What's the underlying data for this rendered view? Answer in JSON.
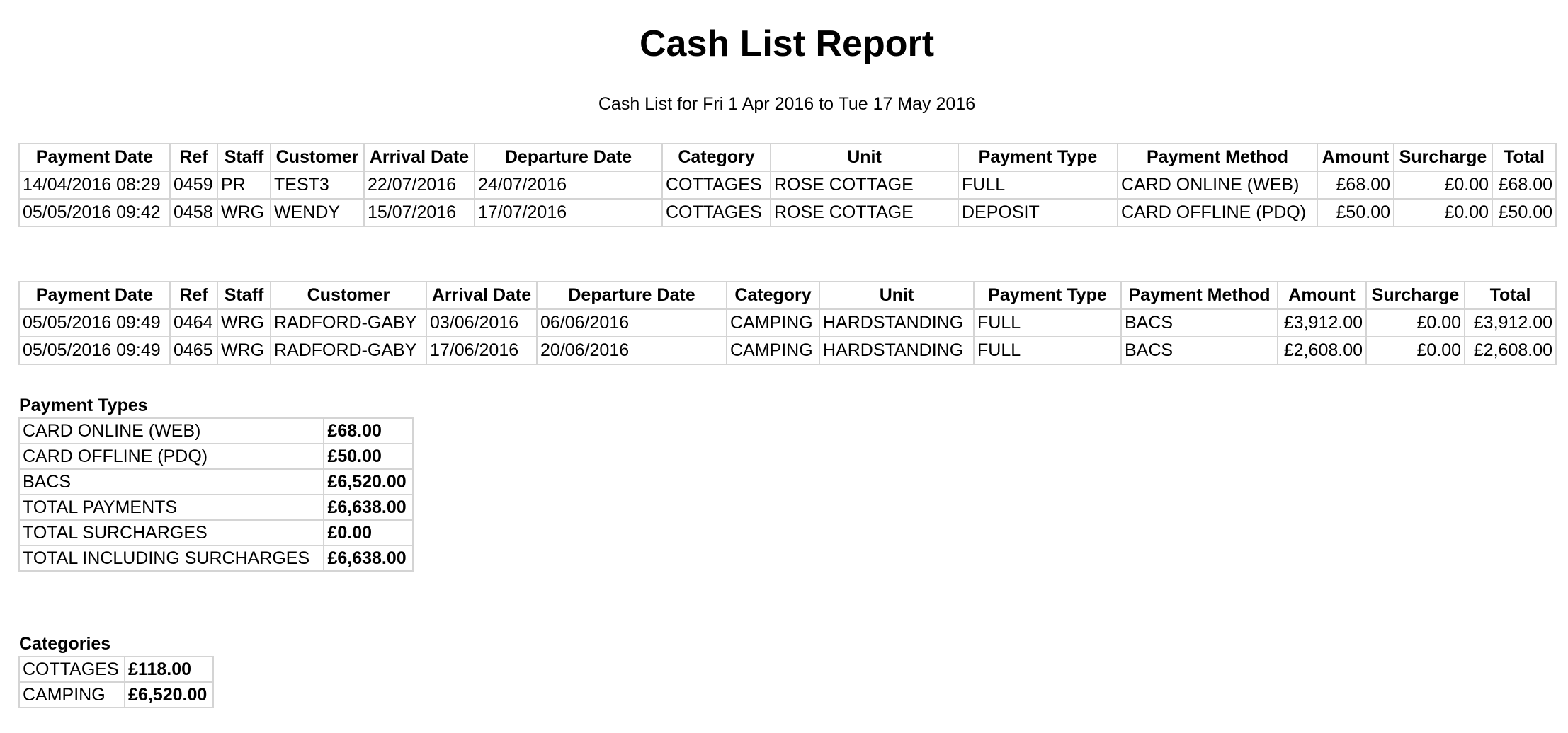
{
  "report": {
    "title": "Cash List Report",
    "subtitle": "Cash List for Fri 1 Apr 2016 to Tue 17 May 2016"
  },
  "columns": [
    "Payment Date",
    "Ref",
    "Staff",
    "Customer",
    "Arrival Date",
    "Departure Date",
    "Category",
    "Unit",
    "Payment Type",
    "Payment Method",
    "Amount",
    "Surcharge",
    "Total"
  ],
  "table1": {
    "rows": [
      [
        "14/04/2016 08:29",
        "0459",
        "PR",
        "TEST3",
        "22/07/2016",
        "24/07/2016",
        "COTTAGES",
        "ROSE COTTAGE",
        "FULL",
        "CARD ONLINE (WEB)",
        "£68.00",
        "£0.00",
        "£68.00"
      ],
      [
        "05/05/2016 09:42",
        "0458",
        "WRG",
        "WENDY",
        "15/07/2016",
        "17/07/2016",
        "COTTAGES",
        "ROSE COTTAGE",
        "DEPOSIT",
        "CARD OFFLINE (PDQ)",
        "£50.00",
        "£0.00",
        "£50.00"
      ]
    ]
  },
  "table2": {
    "rows": [
      [
        "05/05/2016 09:49",
        "0464",
        "WRG",
        "RADFORD-GABY",
        "03/06/2016",
        "06/06/2016",
        "CAMPING",
        "HARDSTANDING",
        "FULL",
        "BACS",
        "£3,912.00",
        "£0.00",
        "£3,912.00"
      ],
      [
        "05/05/2016 09:49",
        "0465",
        "WRG",
        "RADFORD-GABY",
        "17/06/2016",
        "20/06/2016",
        "CAMPING",
        "HARDSTANDING",
        "FULL",
        "BACS",
        "£2,608.00",
        "£0.00",
        "£2,608.00"
      ]
    ]
  },
  "payment_types": {
    "heading": "Payment Types",
    "rows": [
      [
        "CARD ONLINE (WEB)",
        "£68.00"
      ],
      [
        "CARD OFFLINE (PDQ)",
        "£50.00"
      ],
      [
        "BACS",
        "£6,520.00"
      ],
      [
        "TOTAL PAYMENTS",
        "£6,638.00"
      ],
      [
        "TOTAL SURCHARGES",
        "£0.00"
      ],
      [
        "TOTAL INCLUDING SURCHARGES",
        "£6,638.00"
      ]
    ]
  },
  "categories": {
    "heading": "Categories",
    "rows": [
      [
        "COTTAGES",
        "£118.00"
      ],
      [
        "CAMPING",
        "£6,520.00"
      ]
    ]
  }
}
